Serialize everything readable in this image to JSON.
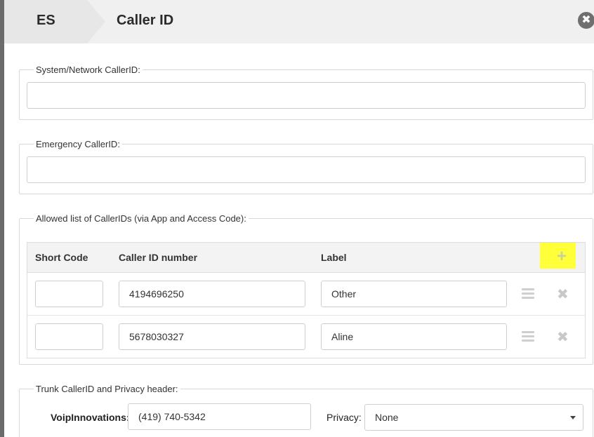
{
  "header": {
    "breadcrumb": "ES",
    "title": "Caller ID",
    "close_icon": "close-icon"
  },
  "system_network": {
    "legend": "System/Network CallerID:",
    "value": ""
  },
  "emergency": {
    "legend": "Emergency CallerID:",
    "value": ""
  },
  "allowed": {
    "legend": "Allowed list of CallerIDs (via App and Access Code):",
    "columns": [
      "Short Code",
      "Caller ID number",
      "Label"
    ],
    "add_icon": "plus-icon",
    "highlight_color": "#ffff3a",
    "rows": [
      {
        "short_code": "",
        "number": "4194696250",
        "label": "Other"
      },
      {
        "short_code": "",
        "number": "5678030327",
        "label": "Aline"
      }
    ]
  },
  "trunk": {
    "legend": "Trunk CallerID and Privacy header:",
    "provider_label": "VoipInnovations:",
    "provider_value": "(419) 740-5342",
    "privacy_label": "Privacy:",
    "privacy_value": "None"
  }
}
